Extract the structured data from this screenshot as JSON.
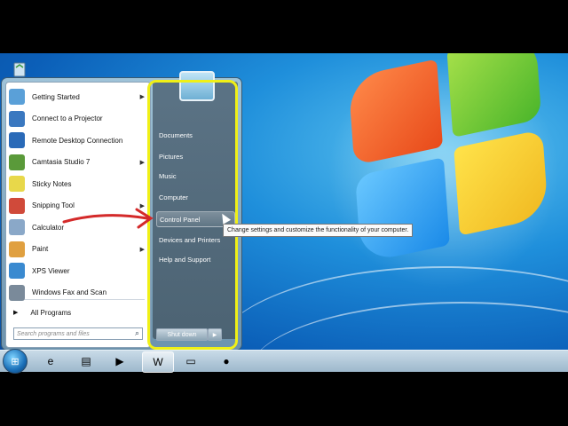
{
  "start_menu": {
    "programs": [
      {
        "label": "Getting Started",
        "has_arrow": true,
        "icon": "getting-started-icon",
        "color": "#5aa0d8"
      },
      {
        "label": "Connect to a Projector",
        "has_arrow": false,
        "icon": "projector-icon",
        "color": "#3a78c0"
      },
      {
        "label": "Remote Desktop Connection",
        "has_arrow": false,
        "icon": "remote-desktop-icon",
        "color": "#2a6ab8"
      },
      {
        "label": "Camtasia Studio 7",
        "has_arrow": true,
        "icon": "camtasia-icon",
        "color": "#5a9a3a"
      },
      {
        "label": "Sticky Notes",
        "has_arrow": false,
        "icon": "sticky-notes-icon",
        "color": "#e8d84a"
      },
      {
        "label": "Snipping Tool",
        "has_arrow": true,
        "icon": "scissors-icon",
        "color": "#d04a3a"
      },
      {
        "label": "Calculator",
        "has_arrow": false,
        "icon": "calculator-icon",
        "color": "#8aa8c8"
      },
      {
        "label": "Paint",
        "has_arrow": true,
        "icon": "paint-icon",
        "color": "#e0a040"
      },
      {
        "label": "XPS Viewer",
        "has_arrow": false,
        "icon": "xps-viewer-icon",
        "color": "#3a8ad0"
      },
      {
        "label": "Windows Fax and Scan",
        "has_arrow": false,
        "icon": "fax-scan-icon",
        "color": "#7a8a9a"
      }
    ],
    "all_programs": "All Programs",
    "search_placeholder": "Search programs and files",
    "right_items": [
      {
        "label": "Documents"
      },
      {
        "label": "Pictures"
      },
      {
        "label": "Music"
      },
      {
        "label": "Computer"
      },
      {
        "label": "Control Panel"
      },
      {
        "label": "Devices and Printers"
      },
      {
        "label": "Help and Support"
      }
    ],
    "highlighted_item": "Control Panel",
    "shutdown_label": "Shut down"
  },
  "tooltip": "Change settings and customize the functionality of your computer.",
  "taskbar": {
    "start_icon": "windows-orb-icon",
    "items": [
      {
        "icon": "internet-explorer-icon",
        "glyph": "e",
        "active": false
      },
      {
        "icon": "windows-explorer-icon",
        "glyph": "▤",
        "active": false
      },
      {
        "icon": "media-player-icon",
        "glyph": "▶",
        "active": false
      },
      {
        "icon": "word-icon",
        "glyph": "W",
        "active": true
      },
      {
        "icon": "sticky-notes-task-icon",
        "glyph": "▭",
        "active": false
      },
      {
        "icon": "camtasia-recorder-icon",
        "glyph": "●",
        "active": false
      }
    ]
  },
  "colors": {
    "annotation": "#f0f016",
    "annotation_arrow": "#d42a2a"
  }
}
